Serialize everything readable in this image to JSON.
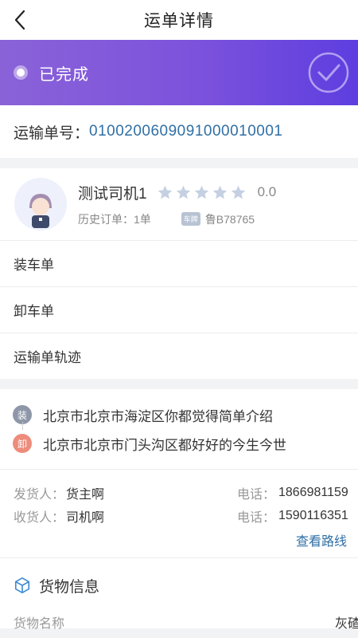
{
  "header": {
    "title": "运单详情",
    "back_icon": "chevron-left-icon"
  },
  "status": {
    "text": "已完成",
    "icon": "check-circle-icon"
  },
  "order": {
    "label": "运输单号：",
    "number": "01002006090910000 10001"
  },
  "driver": {
    "name": "测试司机1",
    "rating_value": "0.0",
    "stars_total": 5,
    "stars_filled": 0,
    "history_label": "历史订单：1单",
    "plate_badge": "车牌",
    "plate": "鲁B78765",
    "avatar_icon": "driver-avatar-icon"
  },
  "menu": {
    "items": [
      {
        "label": "装车单"
      },
      {
        "label": "卸车单"
      },
      {
        "label": "运输单轨迹"
      }
    ]
  },
  "route": {
    "load_badge": "装",
    "load_address": "北京市北京市海淀区你都觉得简单介绍",
    "unload_badge": "卸",
    "unload_address": "北京市北京市门头沟区都好好的今生今世"
  },
  "contacts": {
    "shipper_label": "发货人：",
    "shipper_name": "货主啊",
    "shipper_phone_label": "电话：",
    "shipper_phone": "1866981159",
    "receiver_label": "收货人：",
    "receiver_name": "司机啊",
    "receiver_phone_label": "电话：",
    "receiver_phone": "1590116351",
    "view_route": "查看路线"
  },
  "cargo": {
    "title": "货物信息",
    "icon": "cube-icon",
    "name_label": "货物名称",
    "name_value": "灰碴"
  },
  "colors": {
    "accent_blue": "#2f6fa5",
    "banner_start": "#8a62d8",
    "banner_end": "#5e3ee0",
    "star_inactive": "#c5d0e3",
    "load_badge": "#8d97a8",
    "unload_badge": "#ee8c7c"
  }
}
